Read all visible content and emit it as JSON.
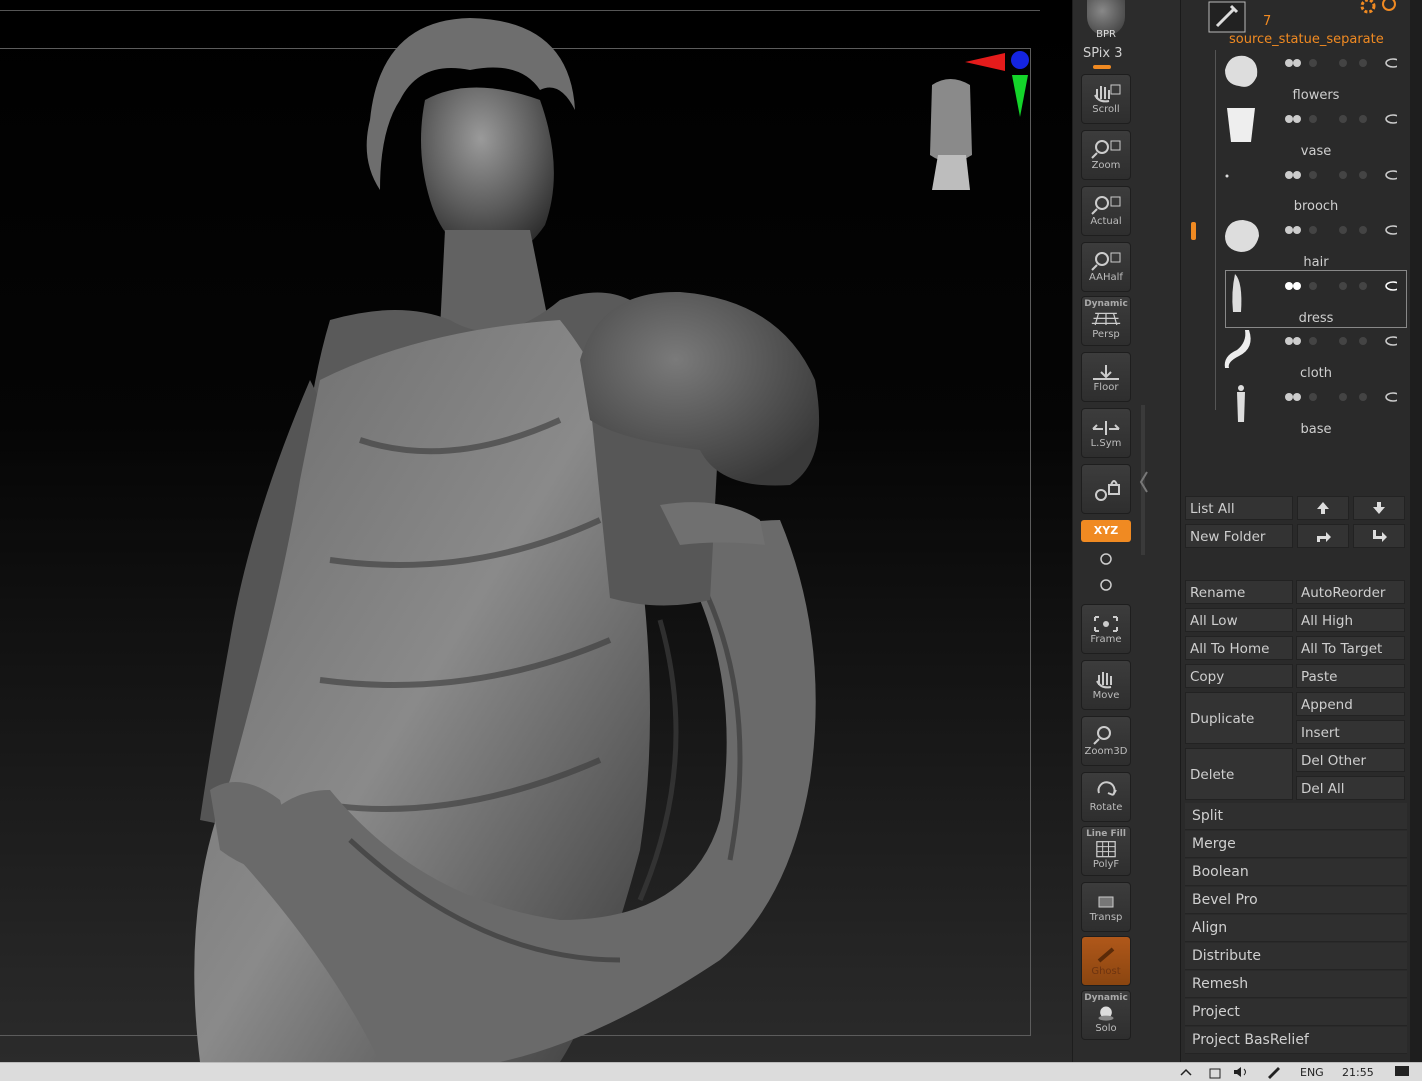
{
  "toolbar": {
    "bpr_label": "BPR",
    "spix_label": "SPix 3",
    "buttons": [
      {
        "label": "Scroll"
      },
      {
        "label": "Zoom"
      },
      {
        "label": "Actual"
      },
      {
        "label": "AAHalf"
      },
      {
        "label": "Persp",
        "sublabel": "Dynamic"
      },
      {
        "label": "Floor"
      },
      {
        "label": "L.Sym"
      },
      {
        "label": ""
      },
      {
        "label": "Frame"
      },
      {
        "label": "Move"
      },
      {
        "label": "Zoom3D"
      },
      {
        "label": "Rotate"
      },
      {
        "label": "PolyF",
        "sublabel": "Line Fill"
      },
      {
        "label": "Transp"
      },
      {
        "label": "Ghost"
      },
      {
        "label": "Solo",
        "sublabel": "Dynamic"
      }
    ],
    "xyz_label": "XYZ",
    "accent_color": "#f08a22"
  },
  "subtool": {
    "count": "7",
    "tool_name": "source_statue_separate",
    "items": [
      {
        "name": "flowers"
      },
      {
        "name": "vase"
      },
      {
        "name": "brooch"
      },
      {
        "name": "hair"
      },
      {
        "name": "dress"
      },
      {
        "name": "cloth"
      },
      {
        "name": "base"
      }
    ]
  },
  "panel": {
    "list_all": "List All",
    "new_folder": "New Folder",
    "rename": "Rename",
    "autoreorder": "AutoReorder",
    "all_low": "All Low",
    "all_high": "All High",
    "all_to_home": "All To Home",
    "all_to_target": "All To Target",
    "copy": "Copy",
    "paste": "Paste",
    "duplicate": "Duplicate",
    "append": "Append",
    "insert": "Insert",
    "delete": "Delete",
    "del_other": "Del Other",
    "del_all": "Del All",
    "menu": [
      "Split",
      "Merge",
      "Boolean",
      "Bevel Pro",
      "Align",
      "Distribute",
      "Remesh",
      "Project",
      "Project BasRelief"
    ]
  },
  "taskbar": {
    "lang": "ENG",
    "time": "21:55"
  }
}
